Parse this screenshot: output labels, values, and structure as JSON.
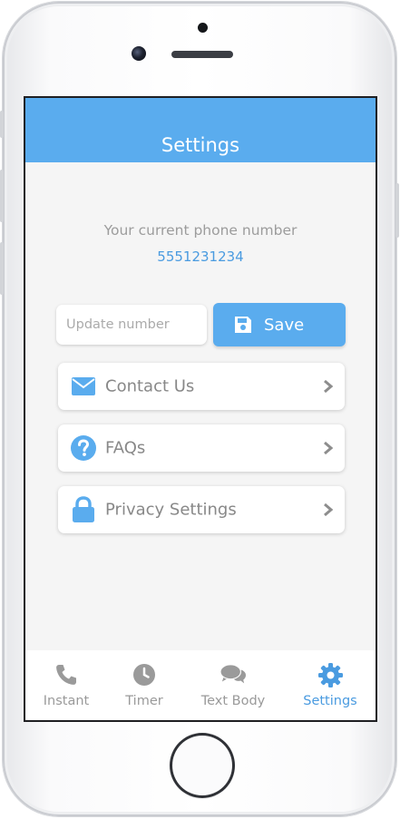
{
  "header": {
    "title": "Settings"
  },
  "phone": {
    "label": "Your current phone number",
    "value": "5551231234"
  },
  "update": {
    "placeholder": "Update number",
    "save_label": "Save"
  },
  "menu": [
    {
      "label": "Contact Us",
      "icon": "envelope-icon"
    },
    {
      "label": "FAQs",
      "icon": "question-circle-icon"
    },
    {
      "label": "Privacy Settings",
      "icon": "lock-icon"
    }
  ],
  "tabs": [
    {
      "label": "Instant",
      "icon": "phone-icon",
      "active": false
    },
    {
      "label": "Timer",
      "icon": "clock-icon",
      "active": false
    },
    {
      "label": "Text Body",
      "icon": "chat-bubbles-icon",
      "active": false
    },
    {
      "label": "Settings",
      "icon": "gear-icon",
      "active": true
    }
  ],
  "colors": {
    "accent": "#5aacee",
    "link": "#4a9be0",
    "inactive": "#9a9a9a",
    "background": "#f5f5f5"
  }
}
